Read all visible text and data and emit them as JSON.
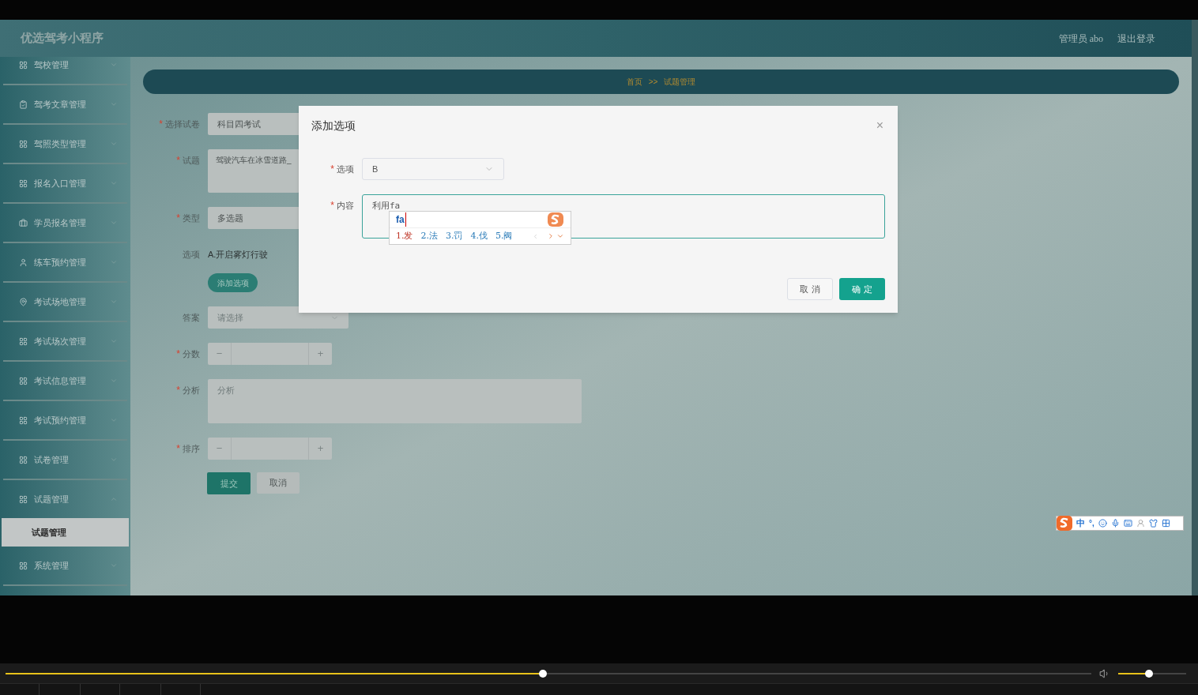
{
  "header": {
    "title": "优选驾考小程序",
    "user": "管理员 abo",
    "logout": "退出登录"
  },
  "sidebar": {
    "items": [
      {
        "label": "驾校管理",
        "kind": "grid",
        "expanded": false
      },
      {
        "label": "驾考文章管理",
        "kind": "clipboard",
        "expanded": false
      },
      {
        "label": "驾照类型管理",
        "kind": "grid",
        "expanded": false
      },
      {
        "label": "报名入口管理",
        "kind": "grid",
        "expanded": false
      },
      {
        "label": "学员报名管理",
        "kind": "briefcase",
        "expanded": false
      },
      {
        "label": "练车预约管理",
        "kind": "user",
        "expanded": false
      },
      {
        "label": "考试场地管理",
        "kind": "pin",
        "expanded": false
      },
      {
        "label": "考试场次管理",
        "kind": "grid",
        "expanded": false
      },
      {
        "label": "考试信息管理",
        "kind": "grid",
        "expanded": false
      },
      {
        "label": "考试预约管理",
        "kind": "grid",
        "expanded": false
      },
      {
        "label": "试卷管理",
        "kind": "grid",
        "expanded": false
      },
      {
        "label": "试题管理",
        "kind": "grid",
        "expanded": true,
        "children": [
          {
            "label": "试题管理",
            "selected": true
          }
        ]
      },
      {
        "label": "系统管理",
        "kind": "grid",
        "expanded": false
      }
    ]
  },
  "breadcrumb": [
    "首页",
    ">>",
    "试题管理"
  ],
  "form": {
    "fields": [
      {
        "kind": "select",
        "label": "选择试卷",
        "mark": "*",
        "value": "科目四考试"
      },
      {
        "kind": "textarea",
        "label": "试题",
        "mark": "*",
        "value": "驾驶汽车在冰雪道路_"
      },
      {
        "kind": "select",
        "label": "类型",
        "mark": "*",
        "value": "多选题"
      },
      {
        "kind": "options",
        "label": "选项",
        "value": "A.开启雾灯行驶",
        "button": "添加选项"
      },
      {
        "kind": "select",
        "label": "答案",
        "placeholder": "请选择"
      },
      {
        "kind": "number",
        "label": "分数",
        "mark": "*",
        "minus": "−",
        "plus": "+"
      },
      {
        "kind": "textarea",
        "label": "分析",
        "mark": "*",
        "placeholder": "分析"
      },
      {
        "kind": "number",
        "label": "排序",
        "mark": "*",
        "minus": "−",
        "plus": "+"
      }
    ],
    "submit": "提交",
    "cancel": "取消"
  },
  "dialog": {
    "title": "添加选项",
    "close": "×",
    "fields": [
      {
        "kind": "select",
        "label": "选项",
        "mark": "*",
        "value": "B"
      },
      {
        "kind": "textarea",
        "label": "内容",
        "mark": "*",
        "value": "利用fa"
      }
    ],
    "cancel": "取 消",
    "confirm": "确 定"
  },
  "ime": {
    "composition": "fa",
    "candidates": [
      {
        "text": "1.发",
        "selected": true
      },
      {
        "text": "2.法",
        "selected": false
      },
      {
        "text": "3.罚",
        "selected": false
      },
      {
        "text": "4.伐",
        "selected": false
      },
      {
        "text": "5.阀",
        "selected": false
      }
    ],
    "toolbar": {
      "mode": "中",
      "punctuation": "°,"
    }
  },
  "player": {
    "progress": {
      "level": 0.495
    },
    "volume": {
      "level": 0.45
    }
  }
}
